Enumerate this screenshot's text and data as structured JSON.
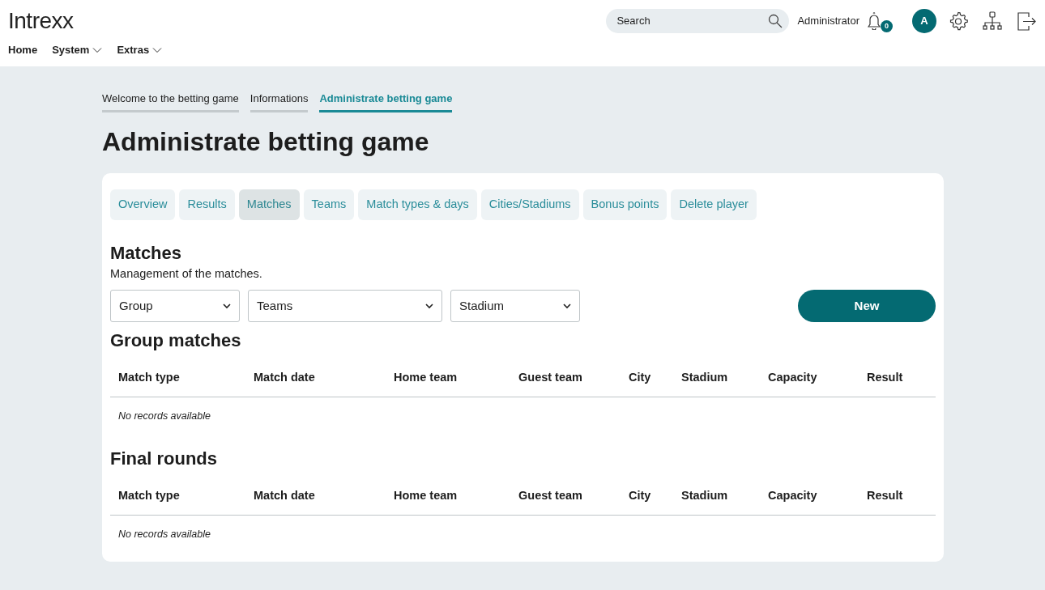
{
  "header": {
    "logo": "Intrexx",
    "search": {
      "placeholder": "Search"
    },
    "user_name": "Administrator",
    "notification_count": "0",
    "avatar_initial": "A"
  },
  "nav": [
    {
      "label": "Home",
      "dropdown": false
    },
    {
      "label": "System",
      "dropdown": true
    },
    {
      "label": "Extras",
      "dropdown": true
    }
  ],
  "page_tabs": [
    {
      "label": "Welcome to the betting game",
      "selected": false
    },
    {
      "label": "Informations",
      "selected": false
    },
    {
      "label": "Administrate betting game",
      "selected": true
    }
  ],
  "page_title": "Administrate betting game",
  "section_tabs": [
    {
      "label": "Overview",
      "selected": false
    },
    {
      "label": "Results",
      "selected": false
    },
    {
      "label": "Matches",
      "selected": true
    },
    {
      "label": "Teams",
      "selected": false
    },
    {
      "label": "Match types & days",
      "selected": false
    },
    {
      "label": "Cities/Stadiums",
      "selected": false
    },
    {
      "label": "Bonus points",
      "selected": false
    },
    {
      "label": "Delete player",
      "selected": false
    }
  ],
  "section": {
    "title": "Matches",
    "description": "Management of the matches."
  },
  "filters": [
    {
      "value": "Group"
    },
    {
      "value": "Teams"
    },
    {
      "value": "Stadium"
    }
  ],
  "new_button": "New",
  "tables": [
    {
      "title": "Group matches",
      "columns": [
        "Match type",
        "Match date",
        "Home team",
        "Guest team",
        "City",
        "Stadium",
        "Capacity",
        "Result"
      ],
      "empty_text": "No records available"
    },
    {
      "title": "Final rounds",
      "columns": [
        "Match type",
        "Match date",
        "Home team",
        "Guest team",
        "City",
        "Stadium",
        "Capacity",
        "Result"
      ],
      "empty_text": "No records available"
    }
  ]
}
